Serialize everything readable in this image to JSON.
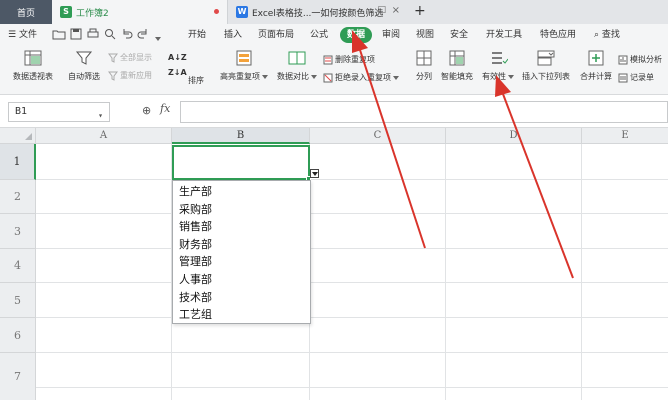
{
  "tabs": {
    "home": "首页",
    "doc1": "工作簿2",
    "doc2": "Excel表格技...一如何按颜色筛选"
  },
  "menu": {
    "file": "文件",
    "start": "开始",
    "insert": "插入",
    "layout": "页面布局",
    "formula": "公式",
    "data": "数据",
    "review": "审阅",
    "view": "视图",
    "security": "安全",
    "developer": "开发工具",
    "special": "特色应用",
    "search": "查找"
  },
  "ribbon": {
    "pivot": "数据透视表",
    "autofilter": "自动筛选",
    "show_all": "全部显示",
    "reapply": "重新应用",
    "sort": "排序",
    "highlight_dup": "高亮重复项",
    "data_compare": "数据对比",
    "remove_dup": "删除重复项",
    "reject_dup": "拒绝录入重复项",
    "split": "分列",
    "smart_fill": "智能填充",
    "validity": "有效性",
    "insert_dropdown": "插入下拉列表",
    "merge_calc": "合并计算",
    "simulate": "模拟分析",
    "record": "记录单"
  },
  "formula_bar": {
    "name_box": "B1",
    "fx": "fx",
    "formula": ""
  },
  "sheet": {
    "columns": [
      "A",
      "B",
      "C",
      "D",
      "E"
    ],
    "rows": [
      "1",
      "2",
      "3",
      "4",
      "5",
      "6",
      "7"
    ],
    "selected_column": "B",
    "selected_row": "1"
  },
  "dropdown": {
    "items": [
      "生产部",
      "采购部",
      "销售部",
      "财务部",
      "管理部",
      "人事部",
      "技术部",
      "工艺组"
    ]
  },
  "colors": {
    "accent_green": "#2f9c55",
    "arrow_red": "#d9342b",
    "home_tab": "#4d5866",
    "wps_blue": "#2b78e4"
  }
}
